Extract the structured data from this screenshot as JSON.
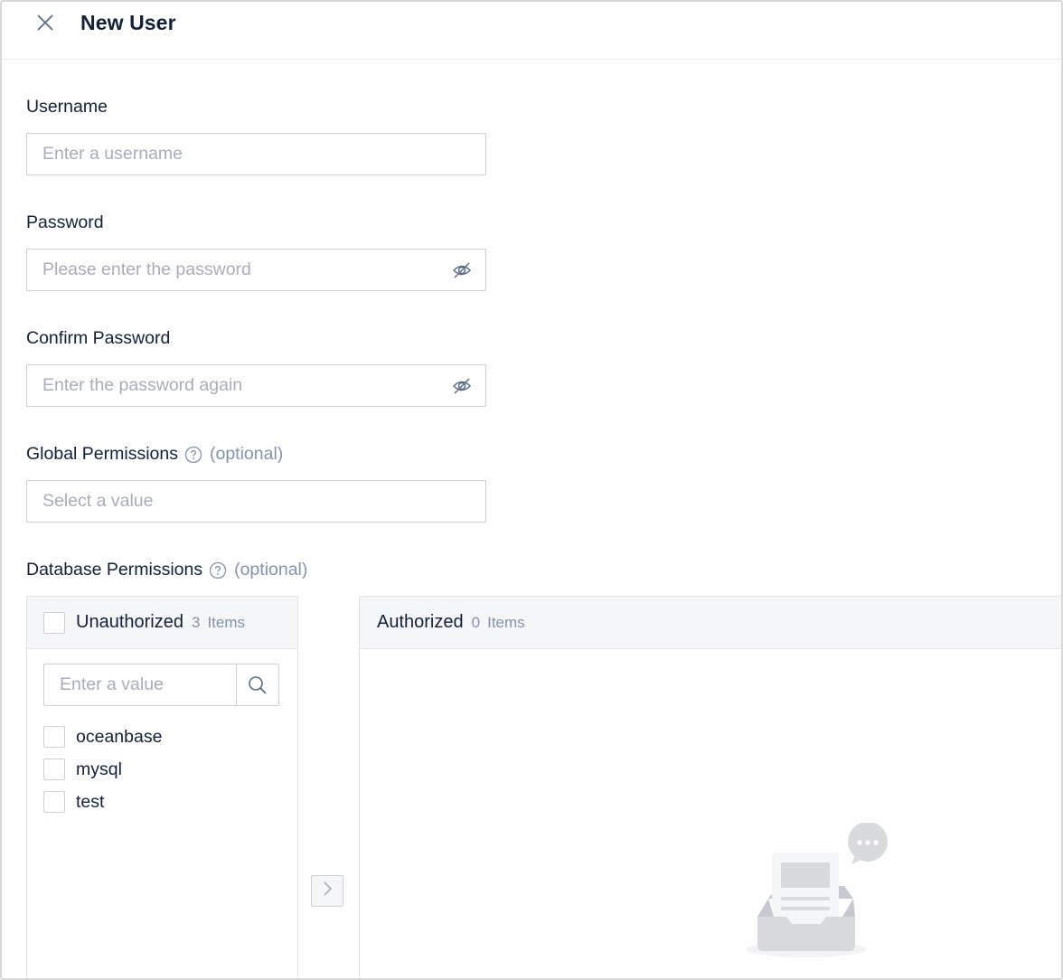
{
  "header": {
    "title": "New User"
  },
  "form": {
    "username": {
      "label": "Username",
      "placeholder": "Enter a username"
    },
    "password": {
      "label": "Password",
      "placeholder": "Please enter the password"
    },
    "confirm_password": {
      "label": "Confirm Password",
      "placeholder": "Enter the password again"
    },
    "global_permissions": {
      "label": "Global Permissions",
      "optional": "(optional)",
      "placeholder": "Select a value"
    },
    "database_permissions": {
      "label": "Database Permissions",
      "optional": "(optional)"
    }
  },
  "transfer": {
    "source": {
      "title": "Unauthorized",
      "count": "3",
      "unit": "Items",
      "search_placeholder": "Enter a value",
      "items": [
        "oceanbase",
        "mysql",
        "test"
      ]
    },
    "target": {
      "title": "Authorized",
      "count": "0",
      "unit": "Items"
    }
  },
  "icons": {
    "close": "close-icon",
    "help": "question-circle-icon",
    "eye": "eye-invisible-icon",
    "search": "search-icon",
    "move_right": "chevron-right-icon",
    "empty": "empty-inbox-icon"
  },
  "colors": {
    "text": "#132039",
    "muted": "#8592ad",
    "border": "#cdd0d6",
    "header_bg": "#f5f6f8"
  }
}
